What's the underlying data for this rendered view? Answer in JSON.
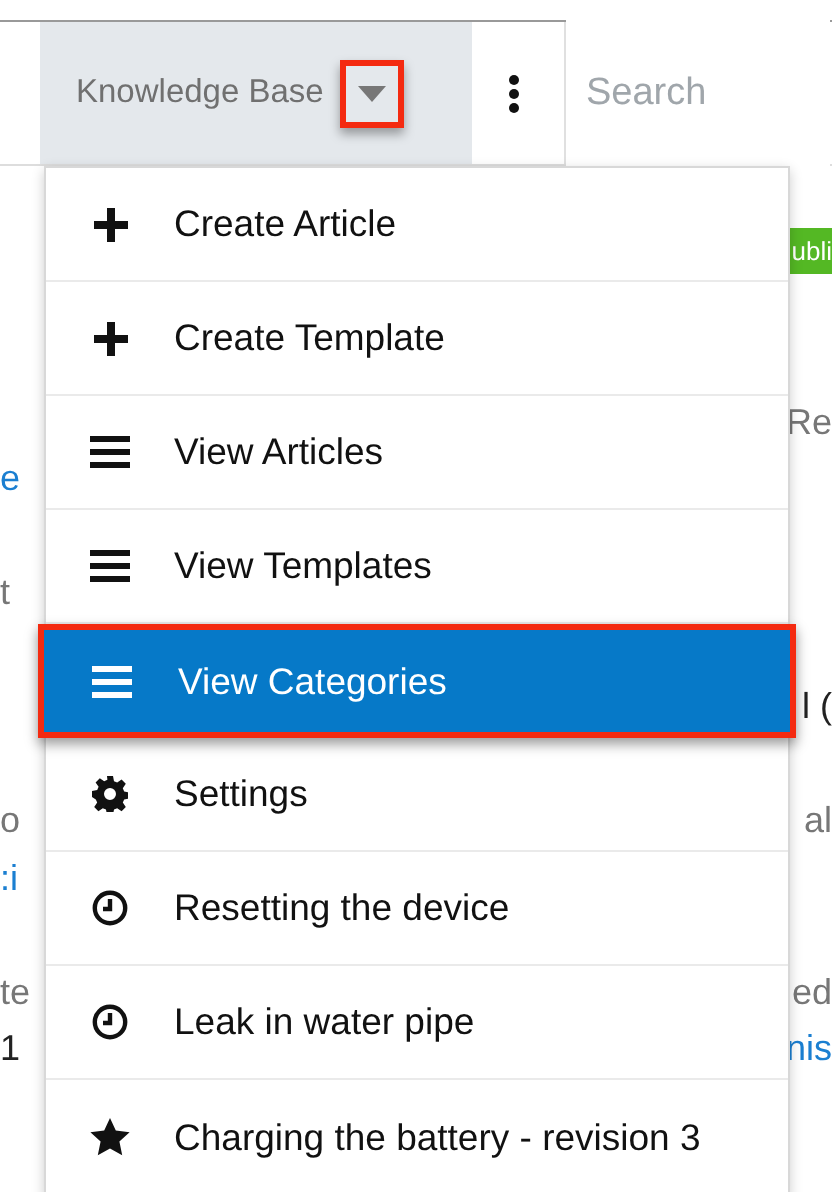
{
  "header": {
    "module_tab": {
      "label": "Knowledge Base",
      "caret_annotated": true
    },
    "search": {
      "placeholder": "Search"
    }
  },
  "menu": [
    {
      "label": "Create Article",
      "kind": "plus",
      "selected": false,
      "annotated": false
    },
    {
      "label": "Create Template",
      "kind": "plus",
      "selected": false,
      "annotated": false
    },
    {
      "label": "View Articles",
      "kind": "list",
      "selected": false,
      "annotated": false
    },
    {
      "label": "View Templates",
      "kind": "list",
      "selected": false,
      "annotated": false
    },
    {
      "label": "View Categories",
      "kind": "list",
      "selected": true,
      "annotated": true
    },
    {
      "label": "Settings",
      "kind": "gear",
      "selected": false,
      "annotated": false
    },
    {
      "label": "Resetting the device",
      "kind": "clock",
      "selected": false,
      "annotated": false
    },
    {
      "label": "Leak in water pipe",
      "kind": "clock",
      "selected": false,
      "annotated": false
    },
    {
      "label": "Charging the battery - revision 3",
      "kind": "star",
      "selected": false,
      "annotated": false
    }
  ],
  "background_rows": [
    {},
    {
      "right": {
        "text": "ubli",
        "kind": "badge"
      }
    },
    {},
    {},
    {
      "right": {
        "text": "Re",
        "kind": "text"
      }
    },
    {
      "left": {
        "text": "e",
        "kind": "link"
      }
    },
    {},
    {
      "left": {
        "text": "t",
        "kind": "text"
      }
    },
    {},
    {
      "right": {
        "text": "l (",
        "kind": "strong"
      }
    },
    {},
    {
      "left": {
        "text": "o",
        "kind": "text"
      },
      "right": {
        "text": "al",
        "kind": "text"
      }
    },
    {
      "left": {
        "text": ":i",
        "kind": "link"
      }
    },
    {},
    {
      "left": {
        "text": "te",
        "kind": "text"
      },
      "right": {
        "text": "ed",
        "kind": "text"
      }
    },
    {
      "left": {
        "text": "1",
        "kind": "strong"
      },
      "right": {
        "text": "nis",
        "kind": "link"
      }
    }
  ]
}
